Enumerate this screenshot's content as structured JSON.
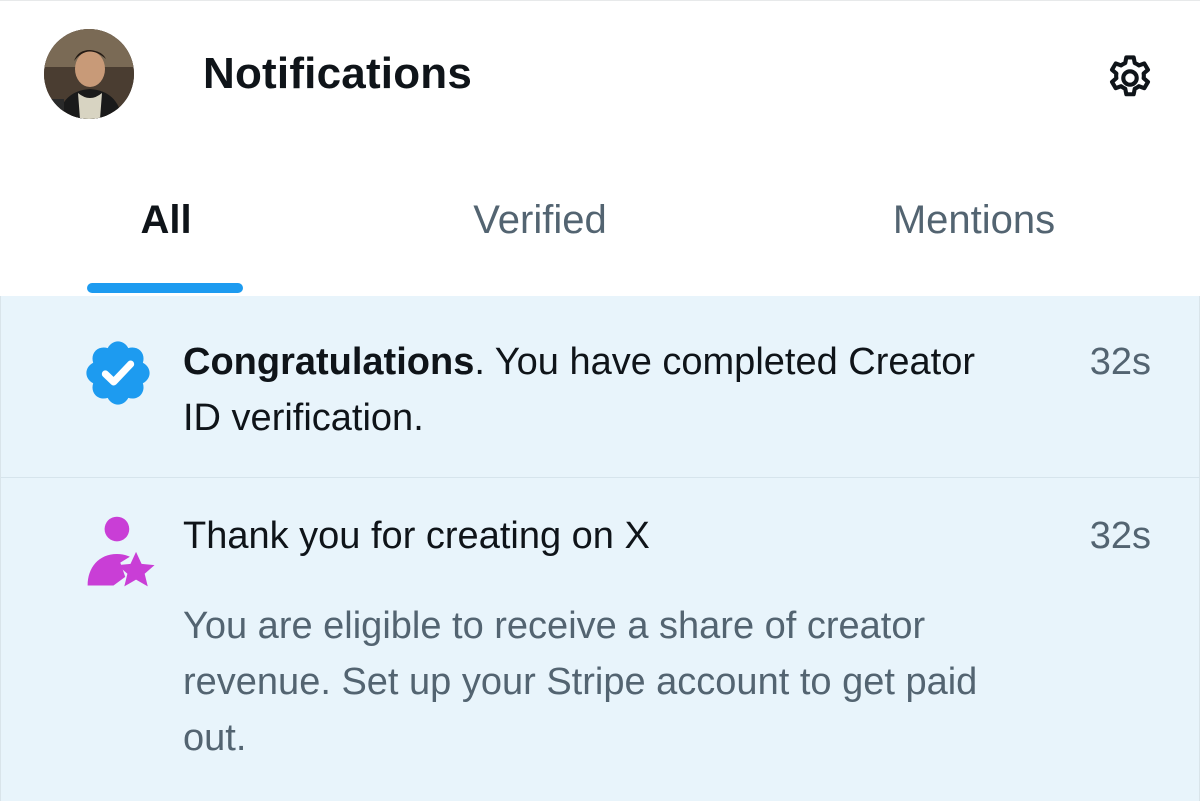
{
  "header": {
    "title": "Notifications",
    "avatar": "user-avatar",
    "settings_icon": "gear-icon"
  },
  "tabs": [
    {
      "label": "All",
      "active": true
    },
    {
      "label": "Verified",
      "active": false
    },
    {
      "label": "Mentions",
      "active": false
    }
  ],
  "notifications": [
    {
      "icon": "verified-badge-icon",
      "title_bold": "Congratulations",
      "title_rest": ".  You have completed Creator ID verification.",
      "time": "32s"
    },
    {
      "icon": "creator-star-icon",
      "title": "Thank you for creating on X",
      "body": "You are eligible to receive a share of creator revenue. Set up your Stripe account to get paid out.",
      "time": "32s"
    }
  ],
  "colors": {
    "accent": "#1d9bf0",
    "unread_background": "#e8f4fb",
    "creator_icon": "#c93ed6",
    "secondary_text": "#536471"
  }
}
